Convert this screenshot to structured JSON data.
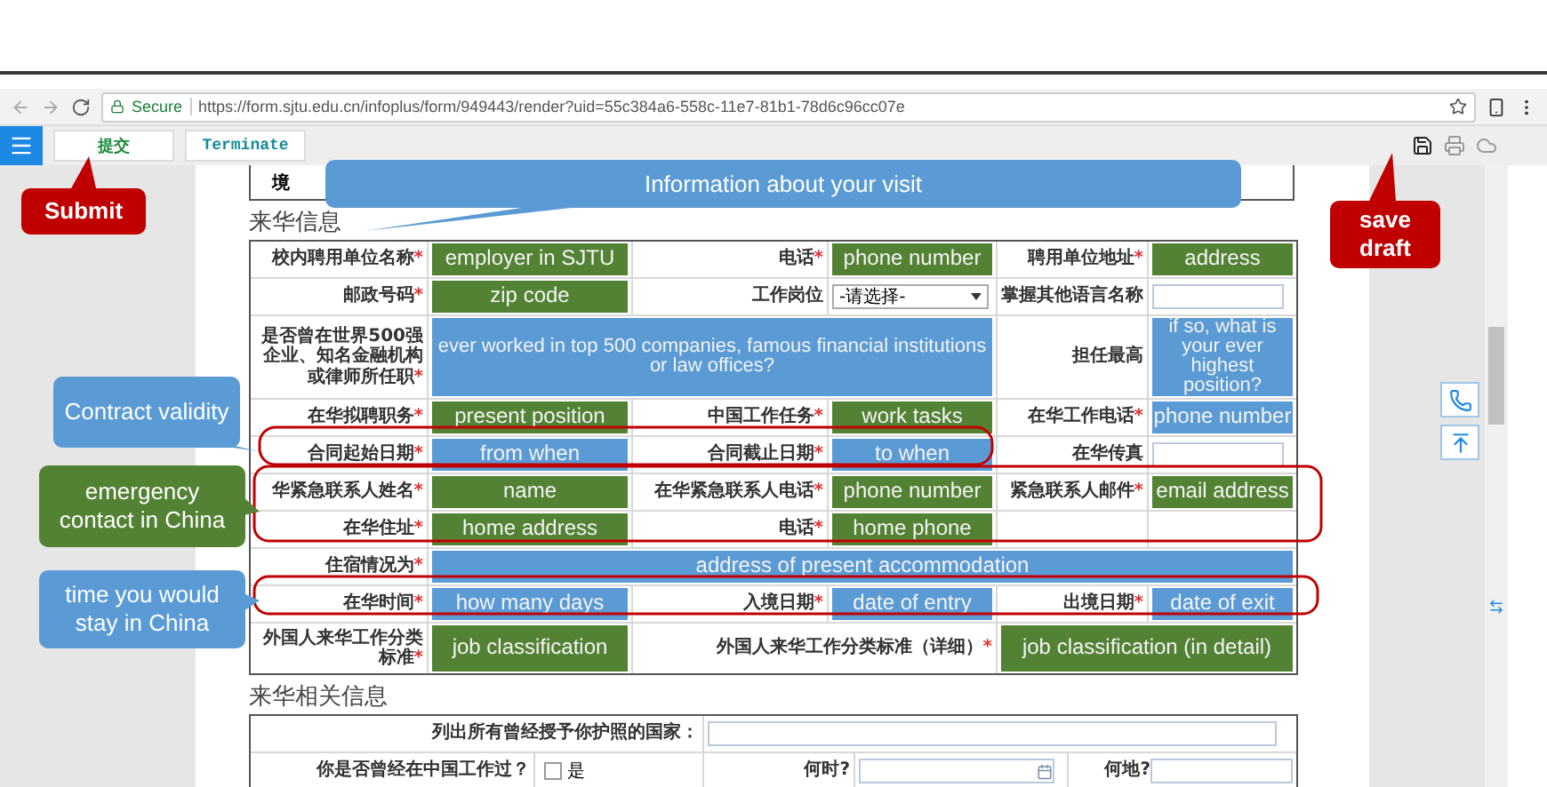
{
  "browser": {
    "secure_label": "Secure",
    "url": "https://form.sjtu.edu.cn/infoplus/form/949443/render?uid=55c384a6-558c-11e7-81b1-78d6c96cc07e"
  },
  "toolbar": {
    "buttons": [
      {
        "label": "提交",
        "kind": "submit"
      },
      {
        "label": "Terminate",
        "kind": "terminate"
      }
    ]
  },
  "form": {
    "fragment": "境",
    "section_title": "来华信息",
    "rows": [
      {
        "kind": "triple",
        "cells": [
          {
            "kind": "label",
            "text": "校内聘用单位名称",
            "mark": "*"
          },
          {
            "kind": "note",
            "text": "employer in SJTU",
            "color": "#548235"
          },
          {
            "kind": "label",
            "text": "电话",
            "mark": "*"
          },
          {
            "kind": "note",
            "text": "phone number",
            "color": "#548235"
          },
          {
            "kind": "label",
            "text": "聘用单位地址",
            "mark": "*"
          },
          {
            "kind": "note",
            "text": "address",
            "color": "#548235"
          }
        ]
      },
      {
        "kind": "triple",
        "cells": [
          {
            "kind": "label",
            "text": "邮政号码",
            "mark": "*"
          },
          {
            "kind": "note",
            "text": "zip code",
            "color": "#548235"
          },
          {
            "kind": "label",
            "text": "工作岗位"
          },
          {
            "kind": "select",
            "text": "-请选择-"
          },
          {
            "kind": "label",
            "text": "掌握其他语言名称"
          },
          {
            "kind": "input"
          }
        ]
      },
      {
        "kind": "question",
        "cells": [
          {
            "kind": "label",
            "text": "是否曾在世界500强企业、知名金融机构或律师所任职",
            "mark": "*"
          },
          {
            "kind": "note",
            "text": "ever worked in top 500 companies, famous financial institutions or law offices?",
            "color": "#5b9bd5"
          },
          "",
          "",
          {
            "kind": "label",
            "text": "担任最高"
          },
          {
            "kind": "note",
            "text": "if so, what is your ever highest position?",
            "color": "#5b9bd5"
          }
        ]
      },
      {
        "kind": "triple",
        "cells": [
          {
            "kind": "label",
            "text": "在华拟聘职务",
            "mark": "*"
          },
          {
            "kind": "note",
            "text": "present position",
            "color": "#548235"
          },
          {
            "kind": "label",
            "text": "中国工作任务",
            "mark": "*"
          },
          {
            "kind": "note",
            "text": "work tasks",
            "color": "#548235"
          },
          {
            "kind": "label",
            "text": "在华工作电话",
            "mark": "*"
          },
          {
            "kind": "note",
            "text": "phone number",
            "color": "#5b9bd5"
          }
        ]
      },
      {
        "kind": "triple",
        "cells": [
          {
            "kind": "label",
            "text": "合同起始日期",
            "mark": "*"
          },
          {
            "kind": "note",
            "text": "from when",
            "color": "#5b9bd5"
          },
          {
            "kind": "label",
            "text": "合同截止日期",
            "mark": "*"
          },
          {
            "kind": "note",
            "text": "to when",
            "color": "#5b9bd5"
          },
          {
            "kind": "label",
            "text": "在华传真"
          },
          {
            "kind": "input"
          }
        ]
      },
      {
        "kind": "triple",
        "cells": [
          {
            "kind": "label",
            "text": "华紧急联系人姓名",
            "mark": "*"
          },
          {
            "kind": "note",
            "text": "name",
            "color": "#548235"
          },
          {
            "kind": "label",
            "text": "在华紧急联系人电话",
            "mark": "*"
          },
          {
            "kind": "note",
            "text": "phone number",
            "color": "#548235"
          },
          {
            "kind": "label",
            "text": "紧急联系人邮件",
            "mark": "*"
          },
          {
            "kind": "note",
            "text": "email address",
            "color": "#548235"
          }
        ]
      },
      {
        "kind": "triple",
        "cells": [
          {
            "kind": "label",
            "text": "在华住址",
            "mark": "*"
          },
          {
            "kind": "note",
            "text": "home address",
            "color": "#548235"
          },
          {
            "kind": "label",
            "text": "电话",
            "mark": "*"
          },
          {
            "kind": "note",
            "text": "home phone",
            "color": "#548235"
          },
          {
            "kind": "empty"
          },
          {
            "kind": "empty"
          }
        ]
      },
      {
        "kind": "wide",
        "cells": [
          {
            "kind": "label",
            "text": "住宿情况为",
            "mark": "*"
          },
          {
            "kind": "note",
            "text": "address of present accommodation",
            "color": "#5b9bd5"
          },
          "",
          "",
          "",
          ""
        ]
      },
      {
        "kind": "triple",
        "cells": [
          {
            "kind": "label",
            "text": "在华时间",
            "mark": "*"
          },
          {
            "kind": "note",
            "text": "how many days",
            "color": "#5b9bd5"
          },
          {
            "kind": "label",
            "text": "入境日期",
            "mark": "*"
          },
          {
            "kind": "note",
            "text": "date of entry",
            "color": "#5b9bd5"
          },
          {
            "kind": "label",
            "text": "出境日期",
            "mark": "*"
          },
          {
            "kind": "note",
            "text": "date of exit",
            "color": "#5b9bd5"
          }
        ]
      },
      {
        "kind": "job",
        "cells": [
          {
            "kind": "label",
            "text": "外国人来华工作分类标准",
            "mark": "*"
          },
          {
            "kind": "note",
            "text": "job classification",
            "color": "#548235"
          },
          {
            "kind": "label",
            "text": "外国人来华工作分类标准（详细）",
            "mark": "*"
          },
          "",
          {
            "kind": "note",
            "text": "job classification (in detail)",
            "color": "#548235"
          },
          ""
        ]
      }
    ],
    "related": {
      "title": "来华相关信息",
      "countries_label": "列出所有曾经授予你护照的国家：",
      "worked_label": "你是否曾经在中国工作过？",
      "worked_option": {
        "label": "是",
        "checked": false
      },
      "when_label": "何时?",
      "where_label": "何地?"
    }
  },
  "callouts": [
    {
      "text": "Submit",
      "color": "#c00000"
    },
    {
      "text": "Information about your visit",
      "color": "#5b9bd5"
    },
    {
      "text": "save draft",
      "color": "#c00000"
    },
    {
      "text": "Contract validity",
      "color": "#5b9bd5"
    },
    {
      "text": "emergency contact in China",
      "color": "#548235"
    },
    {
      "text": "time you would stay in China",
      "color": "#5b9bd5"
    }
  ]
}
